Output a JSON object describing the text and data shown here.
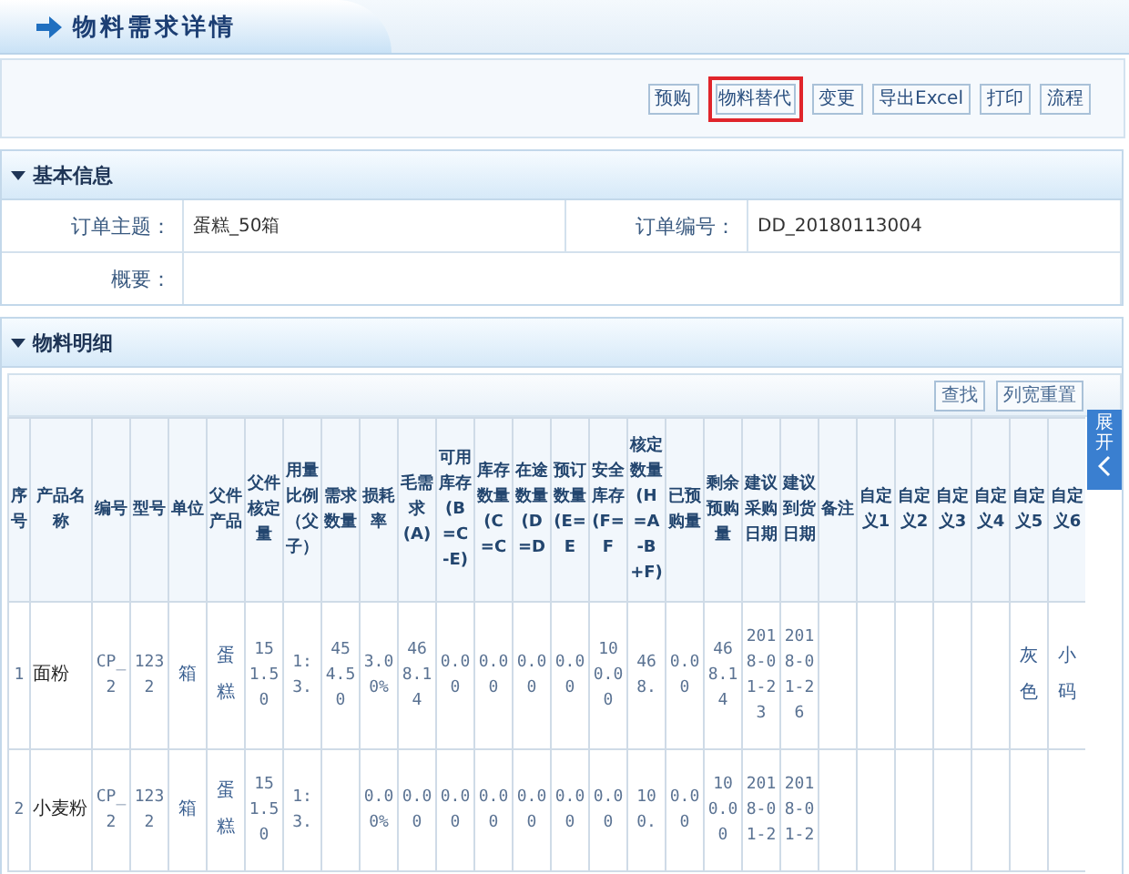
{
  "page_title": "物料需求详情",
  "toolbar": {
    "buttons": [
      {
        "label": "预购",
        "highlighted": false
      },
      {
        "label": "物料替代",
        "highlighted": true
      },
      {
        "label": "变更",
        "highlighted": false
      },
      {
        "label": "导出Excel",
        "highlighted": false
      },
      {
        "label": "打印",
        "highlighted": false
      },
      {
        "label": "流程",
        "highlighted": false
      }
    ]
  },
  "basic_info": {
    "title": "基本信息",
    "expanded": true,
    "fields": [
      {
        "label": "订单主题：",
        "value": "蛋糕_50箱"
      },
      {
        "label": "订单编号：",
        "value": "DD_20180113004"
      },
      {
        "label": "概要："
      }
    ]
  },
  "materials": {
    "title": "物料明细",
    "expanded": true,
    "buttons": [
      "查找",
      "列宽重置"
    ],
    "columns": [
      "序号",
      "产品名称",
      "编号",
      "型号",
      "单位",
      "父件产品",
      "父件核定量",
      "用量比例（父子）",
      "需求数量",
      "损耗率",
      "毛需求(A)",
      "可用库存(B=C-E)",
      "库存数量(C=C",
      "在途数量(D=D",
      "预订数量(E=E",
      "安全库存(F=F",
      "核定数量(H=A-B+F)",
      "已预购量",
      "剩余预购量",
      "建议采购日期",
      "建议到货日期",
      "备注",
      "自定义1",
      "自定义2",
      "自定义3",
      "自定义4",
      "自定义5",
      "自定义6"
    ],
    "rows": [
      {
        "cells": [
          "1",
          "面粉",
          "CP_2",
          "1232",
          "箱",
          "蛋糕",
          "151.50",
          "1:3.",
          "454.50",
          "3.00%",
          "468.14",
          "0.00",
          "0.00",
          "0.00",
          "0.00",
          "100.00",
          "468.",
          "0.00",
          "468.14",
          "2018-01-23",
          "2018-01-26",
          null,
          null,
          null,
          null,
          null,
          "灰色",
          "小码"
        ]
      },
      {
        "cells": [
          "2",
          "小麦粉",
          "CP_2",
          "1232",
          "箱",
          "蛋糕",
          "151.50",
          "1:3.",
          null,
          "0.00%",
          "0.00",
          "0.00",
          "0.00",
          "0.00",
          "0.00",
          "0.00",
          "100.",
          "0.00",
          "100.00",
          "2018-01-2",
          "2018-01-2",
          null,
          null,
          null,
          null,
          null,
          null,
          null
        ]
      }
    ]
  },
  "side_tab": {
    "label": "展开"
  }
}
